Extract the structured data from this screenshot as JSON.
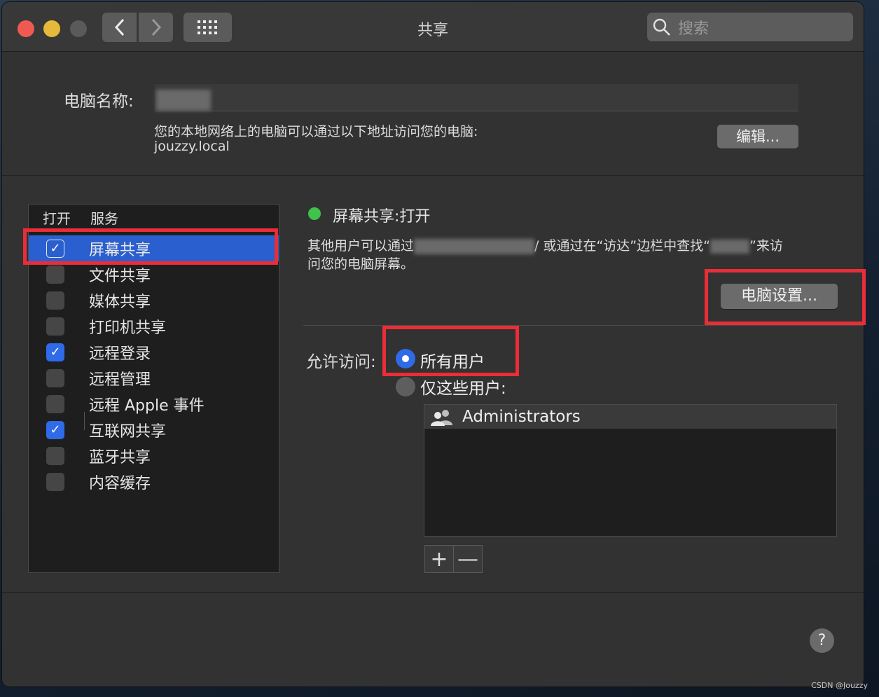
{
  "window": {
    "title": "共享"
  },
  "search": {
    "placeholder": "搜索"
  },
  "computer_name": {
    "label": "电脑名称:",
    "address_note": "您的本地网络上的电脑可以通过以下地址访问您的电脑:",
    "address": "jouzzy.local",
    "edit_label": "编辑..."
  },
  "services": {
    "col_on": "打开",
    "col_service": "服务",
    "items": [
      {
        "name": "屏幕共享",
        "checked": true
      },
      {
        "name": "文件共享",
        "checked": false
      },
      {
        "name": "媒体共享",
        "checked": false
      },
      {
        "name": "打印机共享",
        "checked": false
      },
      {
        "name": "远程登录",
        "checked": true
      },
      {
        "name": "远程管理",
        "checked": false
      },
      {
        "name": "远程 Apple 事件",
        "checked": false
      },
      {
        "name": "互联网共享",
        "checked": true
      },
      {
        "name": "蓝牙共享",
        "checked": false
      },
      {
        "name": "内容缓存",
        "checked": false
      }
    ]
  },
  "detail": {
    "status": "屏幕共享:打开",
    "desc_part1": "其他用户可以通过",
    "desc_part2": "/ 或通过在“访达”边栏中查找“",
    "desc_part3": "”来访",
    "desc_line2": "问您的电脑屏幕。",
    "computer_settings_label": "电脑设置...",
    "allow_label": "允许访问:",
    "option_all": "所有用户",
    "option_only": "仅这些用户:",
    "users": [
      "Administrators"
    ],
    "add": "+",
    "remove": "—"
  },
  "help": "?",
  "watermark": "CSDN @Jouzzy",
  "colors": {
    "accent": "#2f6ae8",
    "annotation": "#ea2d36",
    "status_on": "#3fc34a"
  }
}
